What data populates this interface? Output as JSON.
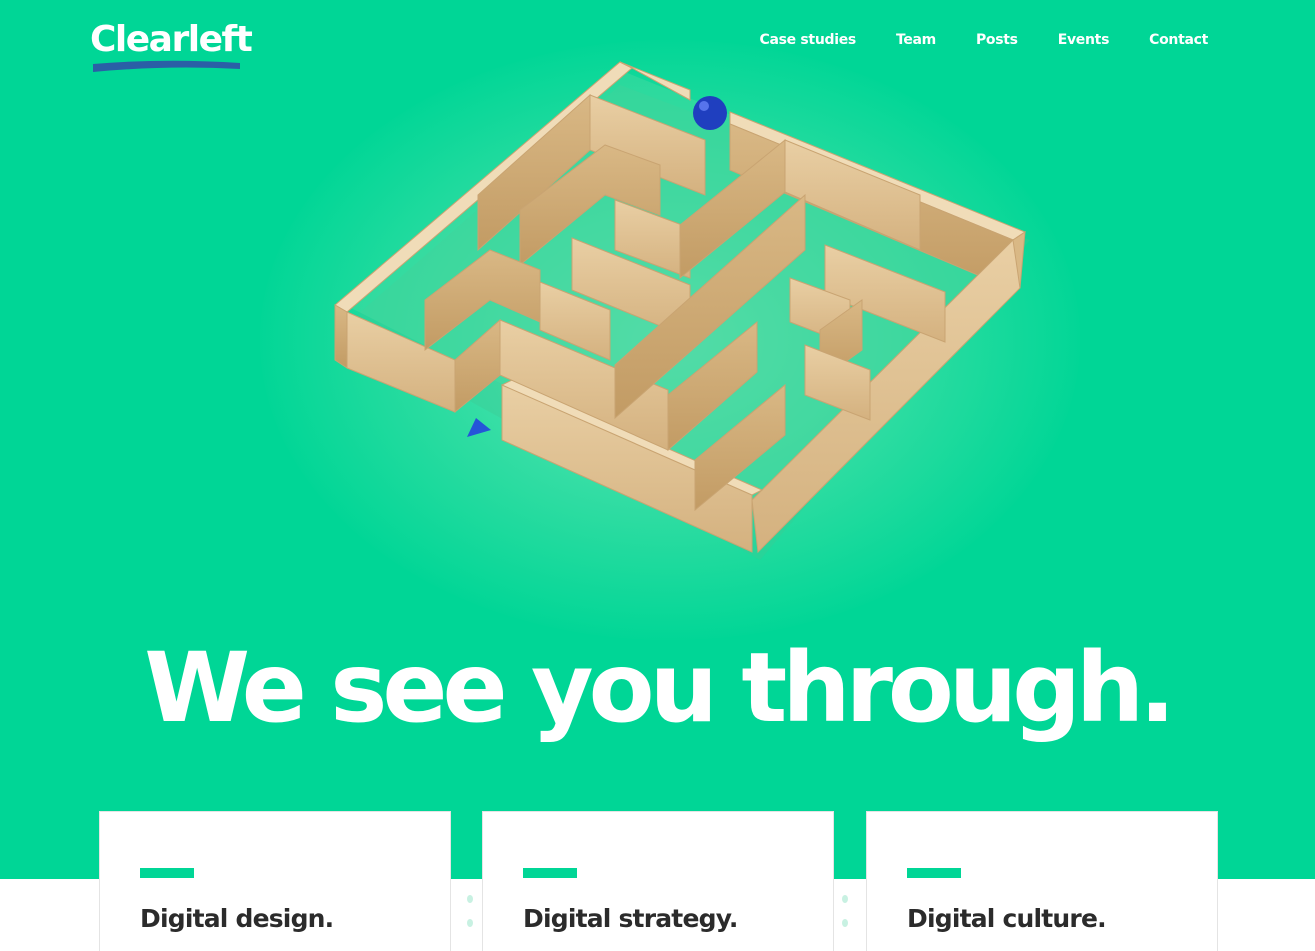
{
  "brand": {
    "logo_text": "Clearleft",
    "accent_color": "#00d696",
    "underline_color": "#2a5fa6"
  },
  "nav": {
    "items": [
      {
        "label": "Case studies"
      },
      {
        "label": "Team"
      },
      {
        "label": "Posts"
      },
      {
        "label": "Events"
      },
      {
        "label": "Contact"
      }
    ]
  },
  "hero": {
    "headline": "We see you through.",
    "image": "wooden-maze-with-blue-marble"
  },
  "services": [
    {
      "title": "Digital design."
    },
    {
      "title": "Digital strategy."
    },
    {
      "title": "Digital culture."
    }
  ]
}
